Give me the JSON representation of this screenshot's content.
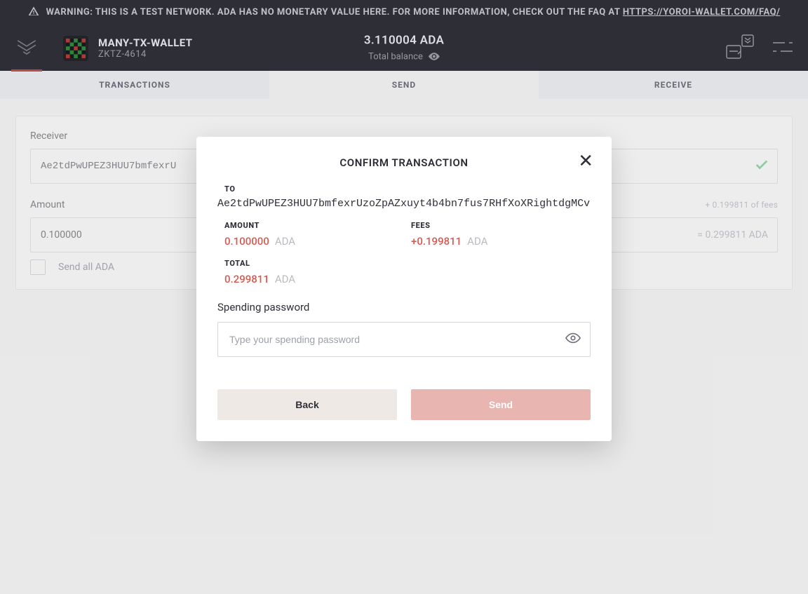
{
  "warning": {
    "text_prefix": "WARNING: THIS IS A TEST NETWORK. ADA HAS NO MONETARY VALUE HERE. FOR MORE INFORMATION, CHECK OUT THE FAQ AT ",
    "link_text": "HTTPS://YOROI-WALLET.COM/FAQ/"
  },
  "header": {
    "wallet_name": "MANY-TX-WALLET",
    "wallet_id": "ZKTZ-4614",
    "balance_amount": "3.110004 ADA",
    "balance_label": "Total balance"
  },
  "tabs": {
    "transactions": "TRANSACTIONS",
    "send": "SEND",
    "receive": "RECEIVE"
  },
  "send_form": {
    "receiver_label": "Receiver",
    "receiver_value": "Ae2tdPwUPEZ3HUU7bmfexrU",
    "amount_label": "Amount",
    "amount_value": "0.100000",
    "fees_text": "+ 0.199811 of fees",
    "total_text": "= 0.299811 ADA",
    "send_all_label": "Send all ADA"
  },
  "modal": {
    "title": "CONFIRM TRANSACTION",
    "to_label": "TO",
    "to_value": "Ae2tdPwUPEZ3HUU7bmfexrUzoZpAZxuyt4b4bn7fus7RHfXoXRightdgMCv",
    "amount_label": "AMOUNT",
    "amount_value": "0.100000",
    "amount_currency": "ADA",
    "fees_label": "FEES",
    "fees_value": "+0.199811",
    "fees_currency": "ADA",
    "total_label": "TOTAL",
    "total_value": "0.299811",
    "total_currency": "ADA",
    "password_label": "Spending password",
    "password_placeholder": "Type your spending password",
    "back_label": "Back",
    "send_label": "Send"
  }
}
